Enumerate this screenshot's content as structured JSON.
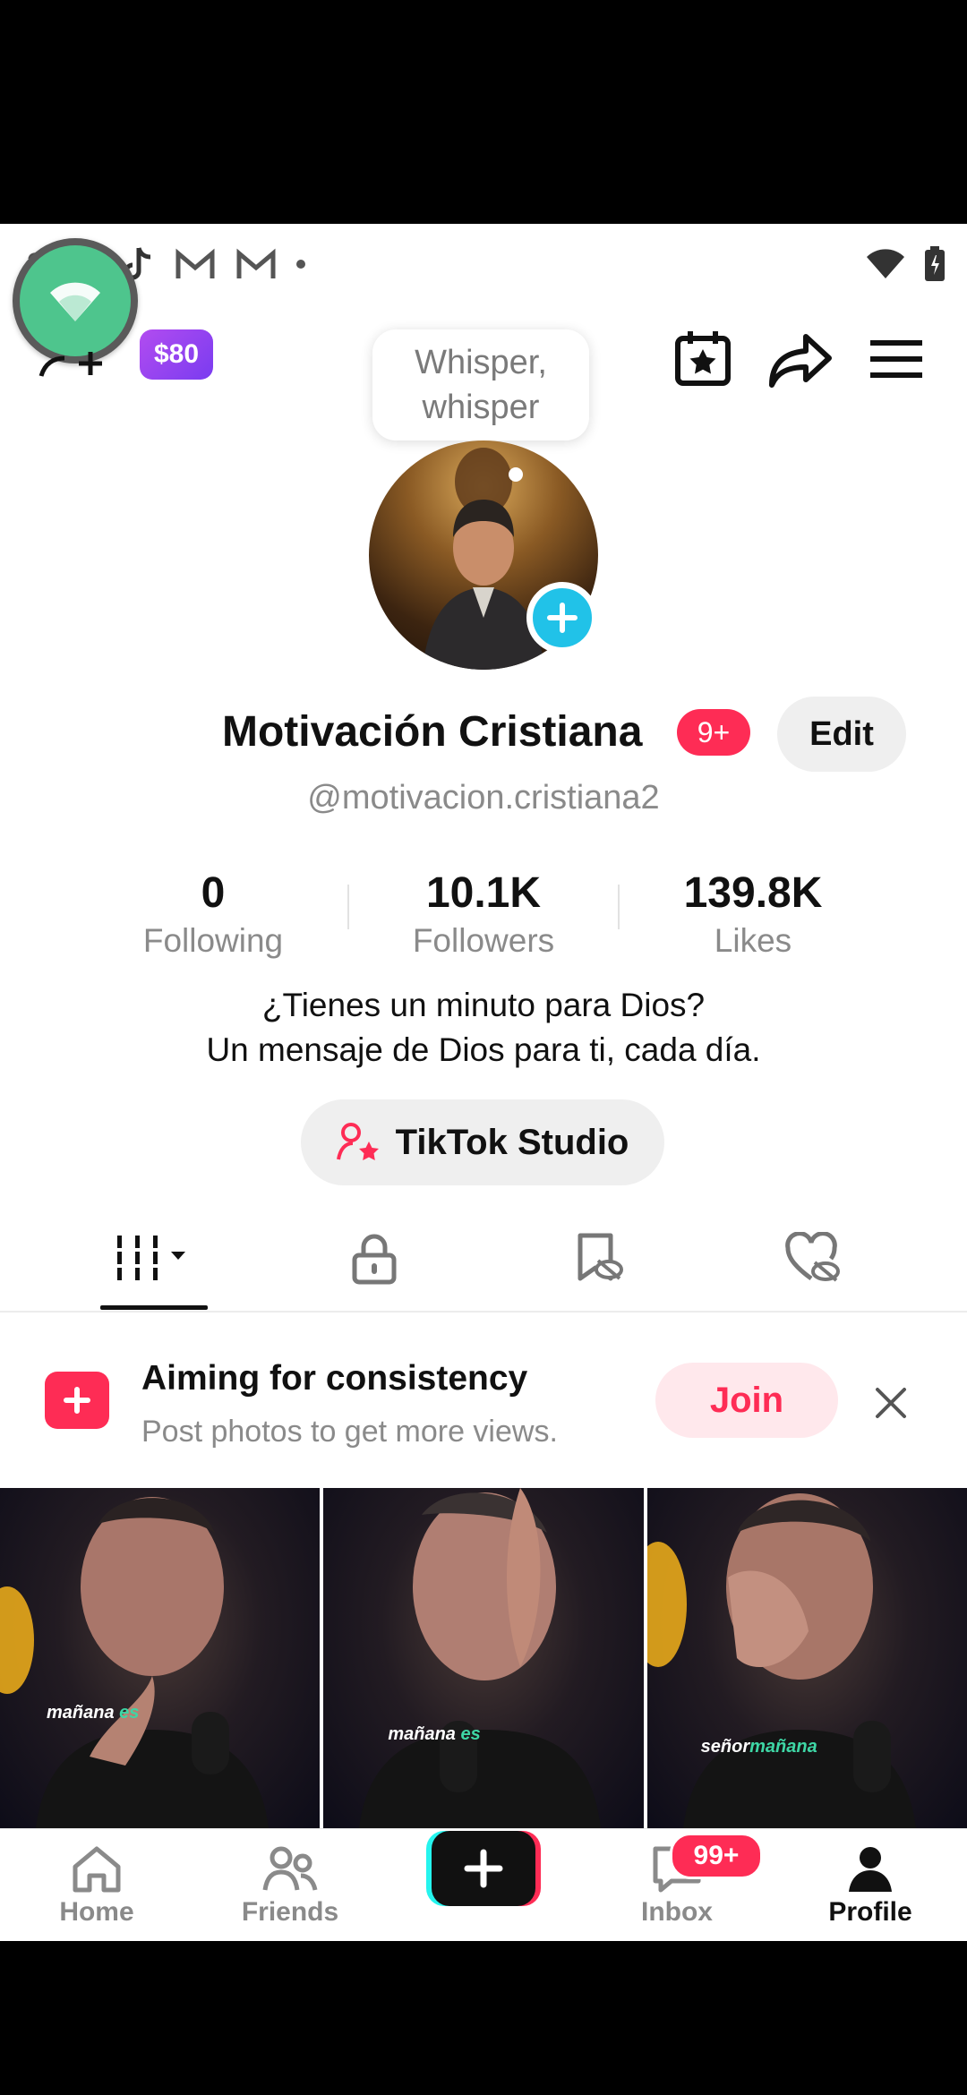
{
  "status_bar": {
    "left_icons": [
      "question-icon",
      "tiktok-icon",
      "tiktok-icon",
      "gmail-icon",
      "gmail-icon",
      "dot-icon"
    ],
    "right_icons": [
      "wifi-icon",
      "battery-icon"
    ]
  },
  "header": {
    "coin_badge": "$80",
    "icons": [
      "add-friend-icon",
      "calendar-star-icon",
      "share-icon",
      "menu-icon"
    ]
  },
  "whisper_bubble": {
    "line1": "Whisper,",
    "line2": "whisper"
  },
  "profile": {
    "display_name": "Motivación Cristiana",
    "notification_badge": "9+",
    "edit_label": "Edit",
    "username": "@motivacion.cristiana2",
    "stats": [
      {
        "value": "0",
        "label": "Following"
      },
      {
        "value": "10.1K",
        "label": "Followers"
      },
      {
        "value": "139.8K",
        "label": "Likes"
      }
    ],
    "bio_line1": "¿Tienes un minuto para Dios?",
    "bio_line2": "Un mensaje de Dios para ti, cada día.",
    "studio_label": "TikTok Studio"
  },
  "tabs": [
    "videos-grid-tab",
    "private-tab",
    "saved-tab",
    "liked-tab"
  ],
  "promo": {
    "title": "Aiming for consistency",
    "subtitle": "Post photos to get more views.",
    "join_label": "Join"
  },
  "videos": [
    {
      "caption_white": "mañana",
      "caption_accent": " es"
    },
    {
      "caption_white": "mañana",
      "caption_accent": " es"
    },
    {
      "caption_white": "señor",
      "caption_accent": "mañana"
    }
  ],
  "bottom_nav": {
    "home": "Home",
    "friends": "Friends",
    "inbox": "Inbox",
    "inbox_badge": "99+",
    "profile": "Profile"
  },
  "colors": {
    "accent": "#fe2c55",
    "cyan": "#21c2e8",
    "coin": "#8a3ff0"
  }
}
